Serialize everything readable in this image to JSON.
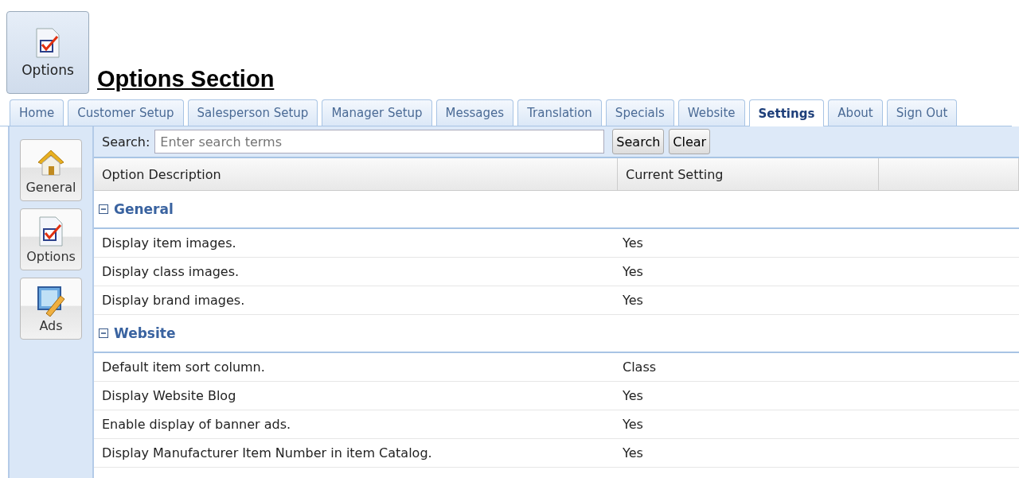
{
  "header": {
    "icon_button": "Options",
    "title": "Options Section"
  },
  "tabs": [
    {
      "label": "Home",
      "selected": false
    },
    {
      "label": "Customer Setup",
      "selected": false
    },
    {
      "label": "Salesperson Setup",
      "selected": false
    },
    {
      "label": "Manager Setup",
      "selected": false
    },
    {
      "label": "Messages",
      "selected": false
    },
    {
      "label": "Translation",
      "selected": false
    },
    {
      "label": "Specials",
      "selected": false
    },
    {
      "label": "Website",
      "selected": false
    },
    {
      "label": "Settings",
      "selected": true
    },
    {
      "label": "About",
      "selected": false
    },
    {
      "label": "Sign Out",
      "selected": false
    }
  ],
  "sidebar": {
    "items": [
      {
        "label": "General",
        "kind": "house"
      },
      {
        "label": "Options",
        "kind": "checklist"
      },
      {
        "label": "Ads",
        "kind": "ads"
      }
    ]
  },
  "search": {
    "label": "Search:",
    "placeholder": "Enter search terms",
    "buttons": [
      "Search",
      "Clear"
    ]
  },
  "table": {
    "columns": [
      "Option Description",
      "Current Setting"
    ],
    "groups": [
      {
        "name": "General",
        "expanded": true,
        "rows": [
          {
            "description": "Display item images.",
            "setting": "Yes"
          },
          {
            "description": "Display class images.",
            "setting": "Yes"
          },
          {
            "description": "Display brand images.",
            "setting": "Yes"
          }
        ]
      },
      {
        "name": "Website",
        "expanded": true,
        "rows": [
          {
            "description": "Default item sort column.",
            "setting": "Class"
          },
          {
            "description": "Display Website Blog",
            "setting": "Yes"
          },
          {
            "description": "Enable display of banner ads.",
            "setting": "Yes"
          },
          {
            "description": "Display Manufacturer Item Number in item Catalog.",
            "setting": "Yes"
          }
        ]
      }
    ]
  }
}
